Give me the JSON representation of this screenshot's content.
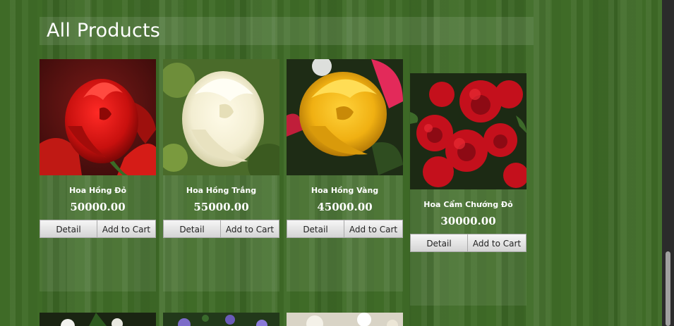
{
  "section": {
    "title": "All Products"
  },
  "buttons": {
    "detail": "Detail",
    "add_to_cart": "Add to Cart"
  },
  "products": [
    {
      "name": "Hoa Hồng Đỏ",
      "price": "50000.00"
    },
    {
      "name": "Hoa Hồng Trắng",
      "price": "55000.00"
    },
    {
      "name": "Hoa Hồng Vàng",
      "price": "45000.00"
    },
    {
      "name": "Hoa Cẩm Chướng Đỏ",
      "price": "30000.00"
    }
  ],
  "colors": {
    "background": "#3f6b27",
    "text": "#ffffff",
    "scrollbar": "#2b2b2b"
  }
}
